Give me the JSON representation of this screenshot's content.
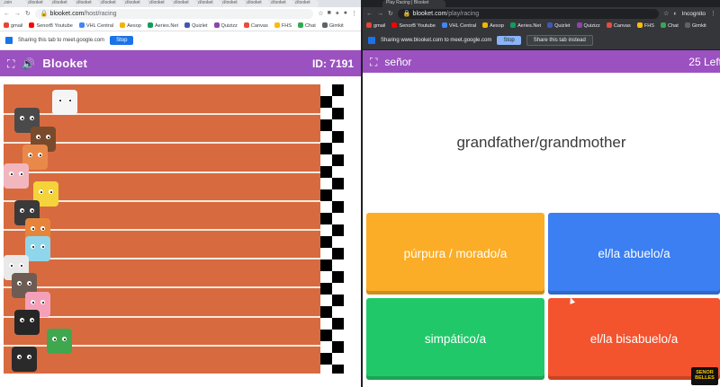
{
  "left_window": {
    "tabs": [
      "Join",
      "Blooket",
      "Blooket",
      "Blooket",
      "Blooket",
      "Blooket",
      "Blooket",
      "Blooket",
      "Blooket",
      "Blooket",
      "Blooket",
      "Blooket",
      "Blooket"
    ],
    "url_host": "blooket.com",
    "url_path": "/host/racing",
    "bookmarks": [
      "gmail",
      "SenorB Youtube",
      "VHL Central",
      "Aesop",
      "Aeries.Net",
      "Quizlet",
      "Quizizz",
      "Canvas",
      "FHS",
      "Chat",
      "Gimkit"
    ],
    "share_bar": {
      "text": "Sharing this tab to meet.google.com",
      "stop_label": "Stop"
    },
    "header": {
      "logo": "Blooket",
      "game_id": "ID: 7191"
    }
  },
  "right_window": {
    "tab": "Play Racing | Blooket",
    "url_host": "blooket.com",
    "url_path": "/play/racing",
    "profile": "Incognito",
    "bookmarks": [
      "gmail",
      "SenorB Youtube",
      "VHL Central",
      "Aesop",
      "Aeries.Net",
      "Quizlet",
      "Quizizz",
      "Canvas",
      "FHS",
      "Chat",
      "Gimkit"
    ],
    "share_bar": {
      "text": "Sharing www.blooket.com to meet.google.com",
      "stop_label": "Stop",
      "share_tab_label": "Share this tab instead"
    },
    "header": {
      "player": "señor",
      "remaining": "25 Left"
    },
    "question": "grandfather/grandmother",
    "answers": [
      {
        "text": "púrpura / morado/a",
        "color": "#fbad27"
      },
      {
        "text": "el/la abuelo/a",
        "color": "#3b7ff2"
      },
      {
        "text": "simpático/a",
        "color": "#21c86a"
      },
      {
        "text": "el/la bisabuelo/a",
        "color": "#f3532d"
      }
    ],
    "watermark": "SENOR BELLES"
  },
  "colors": {
    "blooket_purple": "#9b51c0",
    "track": "#d86a40",
    "lane_line": "#f4eadd"
  },
  "racers": [
    {
      "name": "chicken",
      "color": "#f5f5f5",
      "progress": 0.18
    },
    {
      "name": "cat-gray",
      "color": "#4a4a4a",
      "progress": 0.04
    },
    {
      "name": "dog",
      "color": "#7a4a2c",
      "progress": 0.1
    },
    {
      "name": "fox",
      "color": "#e8894a",
      "progress": 0.07
    },
    {
      "name": "pig",
      "color": "#f2b6bf",
      "progress": 0.0
    },
    {
      "name": "chick",
      "color": "#f5d33a",
      "progress": 0.11
    },
    {
      "name": "bat",
      "color": "#3a3a3a",
      "progress": 0.04
    },
    {
      "name": "tiger",
      "color": "#e6853a",
      "progress": 0.08
    },
    {
      "name": "fishbowl",
      "color": "#8fd6ec",
      "progress": 0.08
    },
    {
      "name": "panda",
      "color": "#e9e9e9",
      "progress": 0.0
    },
    {
      "name": "raccoon",
      "color": "#6d5c54",
      "progress": 0.03
    },
    {
      "name": "pig-2",
      "color": "#f4a0b8",
      "progress": 0.08
    },
    {
      "name": "penguin",
      "color": "#262626",
      "progress": 0.04
    },
    {
      "name": "frog",
      "color": "#3fa84f",
      "progress": 0.16
    },
    {
      "name": "cat-black",
      "color": "#2a2a2a",
      "progress": 0.03
    }
  ]
}
